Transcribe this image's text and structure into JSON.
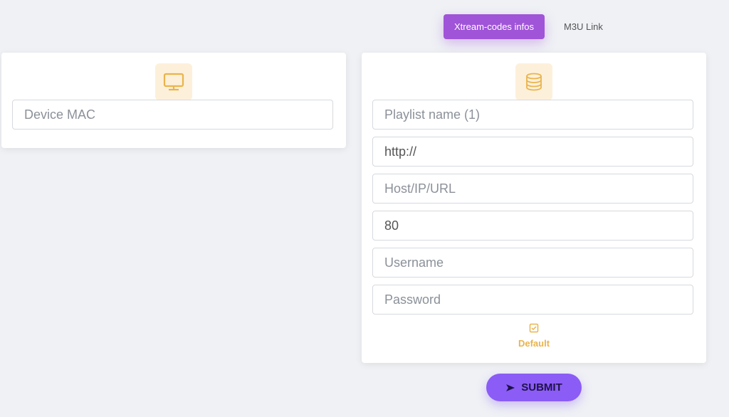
{
  "tabs": [
    {
      "label": "Xtream-codes infos",
      "active": true
    },
    {
      "label": "M3U Link",
      "active": false
    }
  ],
  "left_card": {
    "icon": "monitor-icon",
    "device_mac": {
      "placeholder": "Device MAC",
      "value": ""
    }
  },
  "right_card": {
    "icon": "database-icon",
    "fields": {
      "playlist_name": {
        "placeholder": "Playlist name (1)",
        "value": ""
      },
      "protocol": {
        "placeholder": "",
        "value": "http://"
      },
      "host": {
        "placeholder": "Host/IP/URL",
        "value": ""
      },
      "port": {
        "placeholder": "",
        "value": "80"
      },
      "username": {
        "placeholder": "Username",
        "value": ""
      },
      "password": {
        "placeholder": "Password",
        "value": ""
      }
    },
    "default": {
      "label": "Default",
      "checked": true
    }
  },
  "submit": {
    "label": "SUBMIT",
    "icon": "send-icon"
  },
  "colors": {
    "accent": "#a054d8",
    "submit": "#8b5cf6",
    "icon": "#e9b44c",
    "icon_bg": "#fdf0da"
  }
}
